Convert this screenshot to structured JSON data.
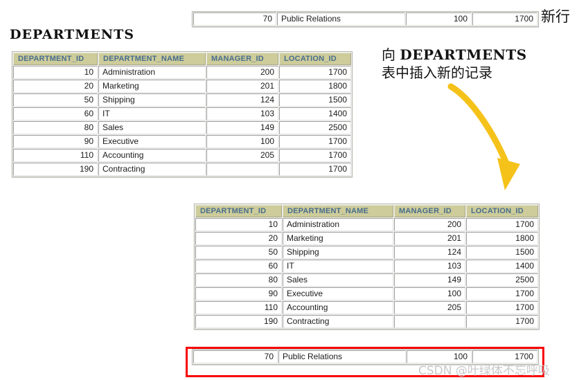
{
  "title": "DEPARTMENTS",
  "new_row_label": "新行",
  "annotation": {
    "line1_prefix": "向",
    "line1_table": "DEPARTMENTS",
    "line2": "表中插入新的记录"
  },
  "watermark": "CSDN @叶绿体不忘呼吸",
  "colors": {
    "header_bg": "#cdcc9a",
    "header_text": "#486d8d",
    "arrow": "#f5c21a",
    "highlight_border": "#f80000",
    "watermark_text": "#c9c9c9"
  },
  "columns": [
    "DEPARTMENT_ID",
    "DEPARTMENT_NAME",
    "MANAGER_ID",
    "LOCATION_ID"
  ],
  "new_row": {
    "department_id": "70",
    "department_name": "Public Relations",
    "manager_id": "100",
    "location_id": "1700"
  },
  "table_before": {
    "name": "DEPARTMENTS",
    "rows": [
      {
        "department_id": "10",
        "department_name": "Administration",
        "manager_id": "200",
        "location_id": "1700"
      },
      {
        "department_id": "20",
        "department_name": "Marketing",
        "manager_id": "201",
        "location_id": "1800"
      },
      {
        "department_id": "50",
        "department_name": "Shipping",
        "manager_id": "124",
        "location_id": "1500"
      },
      {
        "department_id": "60",
        "department_name": "IT",
        "manager_id": "103",
        "location_id": "1400"
      },
      {
        "department_id": "80",
        "department_name": "Sales",
        "manager_id": "149",
        "location_id": "2500"
      },
      {
        "department_id": "90",
        "department_name": "Executive",
        "manager_id": "100",
        "location_id": "1700"
      },
      {
        "department_id": "110",
        "department_name": "Accounting",
        "manager_id": "205",
        "location_id": "1700"
      },
      {
        "department_id": "190",
        "department_name": "Contracting",
        "manager_id": "",
        "location_id": "1700"
      }
    ]
  },
  "table_after": {
    "name": "DEPARTMENTS",
    "rows": [
      {
        "department_id": "10",
        "department_name": "Administration",
        "manager_id": "200",
        "location_id": "1700"
      },
      {
        "department_id": "20",
        "department_name": "Marketing",
        "manager_id": "201",
        "location_id": "1800"
      },
      {
        "department_id": "50",
        "department_name": "Shipping",
        "manager_id": "124",
        "location_id": "1500"
      },
      {
        "department_id": "60",
        "department_name": "IT",
        "manager_id": "103",
        "location_id": "1400"
      },
      {
        "department_id": "80",
        "department_name": "Sales",
        "manager_id": "149",
        "location_id": "2500"
      },
      {
        "department_id": "90",
        "department_name": "Executive",
        "manager_id": "100",
        "location_id": "1700"
      },
      {
        "department_id": "110",
        "department_name": "Accounting",
        "manager_id": "205",
        "location_id": "1700"
      },
      {
        "department_id": "190",
        "department_name": "Contracting",
        "manager_id": "",
        "location_id": "1700"
      }
    ],
    "inserted_row": {
      "department_id": "70",
      "department_name": "Public Relations",
      "manager_id": "100",
      "location_id": "1700"
    }
  }
}
